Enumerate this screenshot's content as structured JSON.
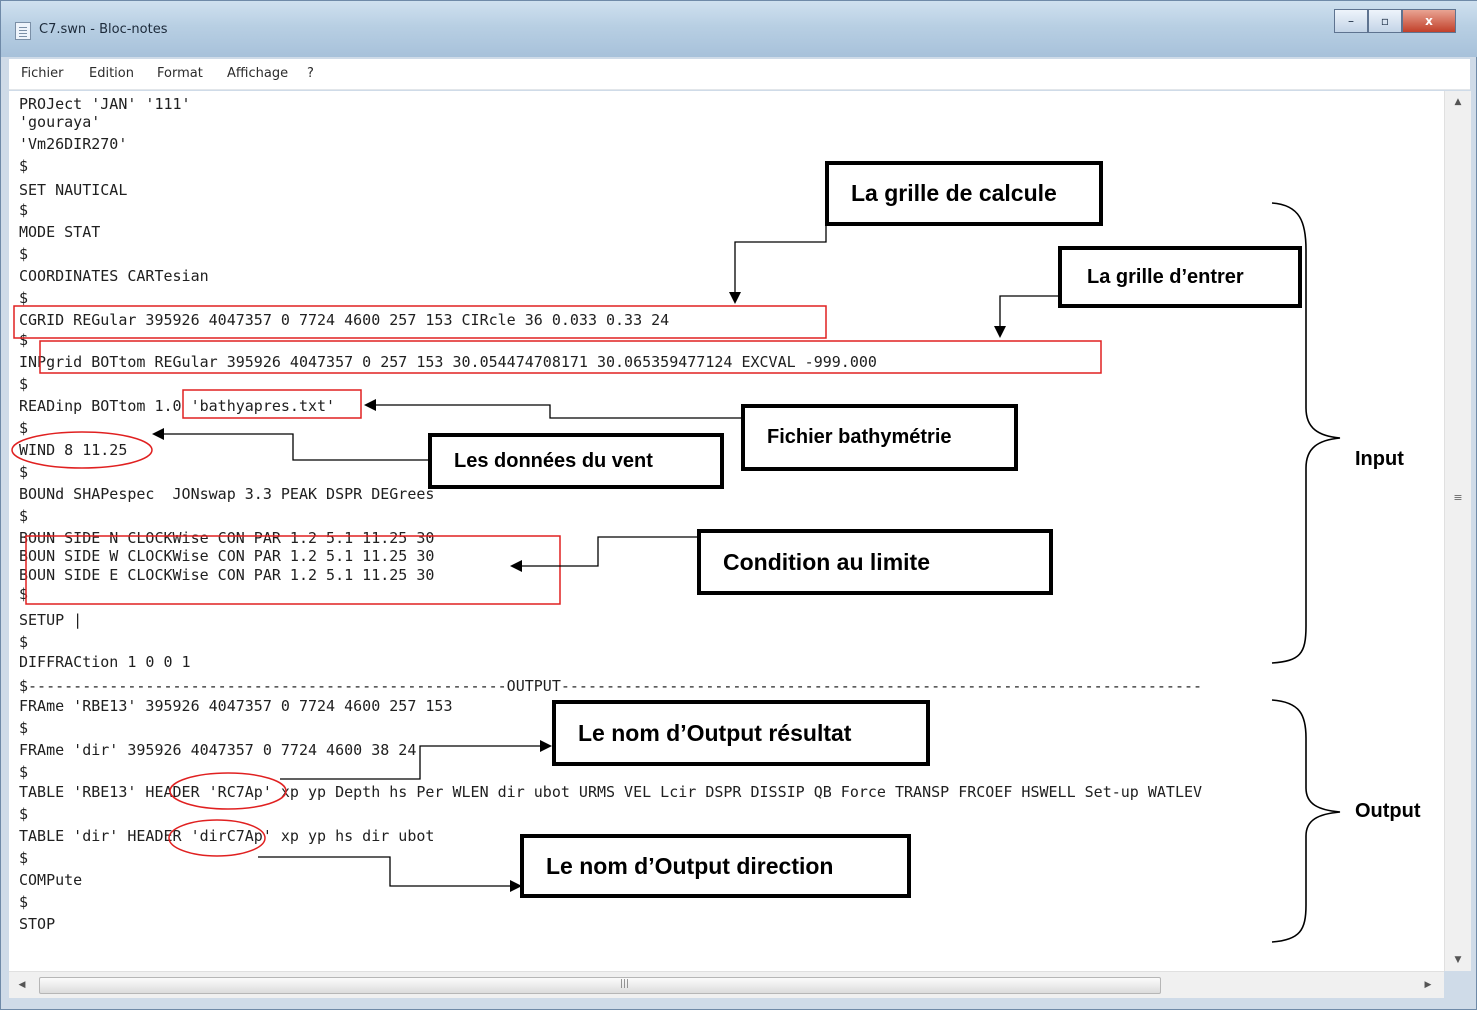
{
  "window": {
    "title": "C7.swn - Bloc-notes"
  },
  "window_buttons": {
    "minimize": "–",
    "maximize": "▫",
    "close": "x"
  },
  "menu": [
    "Fichier",
    "Edition",
    "Format",
    "Affichage",
    "?"
  ],
  "lines": [
    "PROJect 'JAN' '111'",
    "'gouraya'",
    "'Vm26DIR270'",
    "$",
    "SET NAUTICAL",
    "$",
    "MODE STAT",
    "$",
    "COORDINATES CARTesian",
    "$",
    "CGRID REGular 395926 4047357 0 7724 4600 257 153 CIRcle 36 0.033 0.33 24",
    "$",
    "INPgrid BOTtom REGular 395926 4047357 0 257 153 30.054474708171 30.065359477124 EXCVAL -999.000",
    "$",
    "READinp BOTtom 1.0 'bathyapres.txt'",
    "$",
    "WIND 8 11.25",
    "$",
    "BOUNd SHAPespec  JONswap 3.3 PEAK DSPR DEGrees",
    "$",
    "BOUN SIDE N CLOCKWise CON PAR 1.2 5.1 11.25 30",
    "BOUN SIDE W CLOCKWise CON PAR 1.2 5.1 11.25 30",
    "BOUN SIDE E CLOCKWise CON PAR 1.2 5.1 11.25 30",
    "$",
    "SETUP |",
    "$",
    "DIFFRACtion 1 0 0 1",
    "$-----------------------------------------------------OUTPUT-----------------------------------------------------------------------",
    "FRAme 'RBE13' 395926 4047357 0 7724 4600 257 153",
    "$",
    "FRAme 'dir' 395926 4047357 0 7724 4600 38 24",
    "$",
    "TABLE 'RBE13' HEADER 'RC7Ap' xp yp Depth hs Per WLEN dir ubot URMS VEL Lcir DSPR DISSIP QB Force TRANSP FRCOEF HSWELL Set-up WATLEV",
    "$",
    "TABLE 'dir' HEADER 'dirC7Ap' xp yp hs dir ubot",
    "$",
    "COMPute",
    "$",
    "STOP"
  ],
  "annotations": {
    "grille_calcule": "La grille de calcule",
    "grille_entrer": "La grille d’entrer",
    "fichier_bathy": "Fichier bathymétrie",
    "donnees_vent": "Les données du vent",
    "condition_limite": "Condition au limite",
    "nom_output_resultat": "Le nom d’Output résultat",
    "nom_output_direction": "Le nom d’Output direction"
  },
  "brackets": {
    "input": "Input",
    "output": "Output"
  },
  "scroll": {
    "up": "▲",
    "down": "▼",
    "left": "◀",
    "right": "▶",
    "grip": "|||",
    "vgrip": "≡"
  }
}
